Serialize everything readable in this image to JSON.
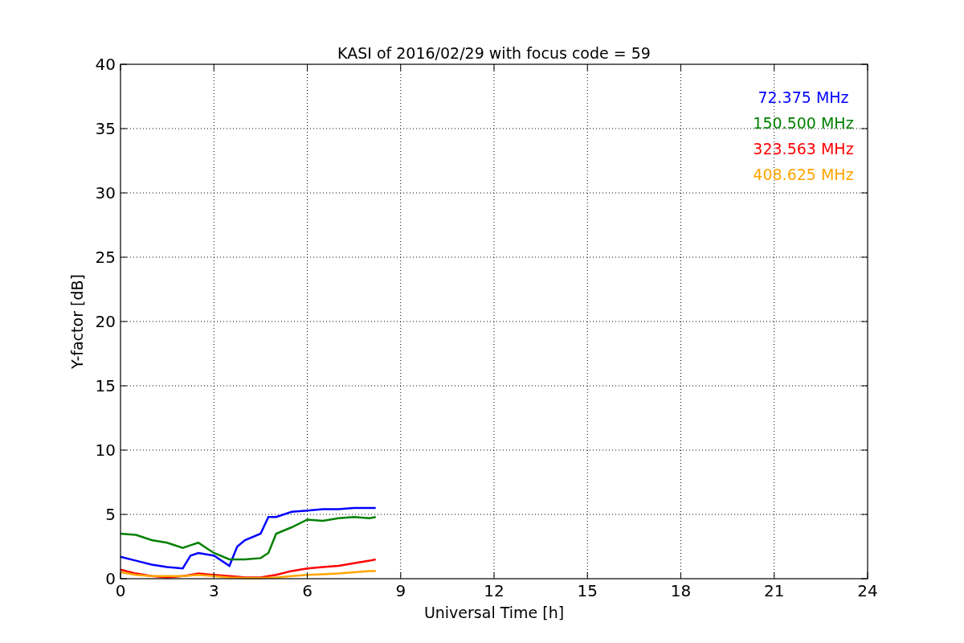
{
  "chart_data": {
    "type": "line",
    "title": "KASI of 2016/02/29 with focus code = 59",
    "xlabel": "Universal Time [h]",
    "ylabel": "Y-factor [dB]",
    "x": [
      0,
      0.5,
      1,
      1.5,
      2,
      2.25,
      2.5,
      3,
      3.5,
      3.75,
      4,
      4.5,
      4.75,
      5,
      5.5,
      6,
      6.5,
      7,
      7.5,
      8,
      8.2
    ],
    "series": [
      {
        "name": "72.375 MHz",
        "color": "#0000ff",
        "values": [
          1.7,
          1.4,
          1.1,
          0.9,
          0.8,
          1.8,
          2.0,
          1.8,
          1.0,
          2.5,
          3.0,
          3.5,
          4.8,
          4.8,
          5.2,
          5.3,
          5.4,
          5.4,
          5.5,
          5.5,
          5.5
        ]
      },
      {
        "name": "150.500 MHz",
        "color": "#008000",
        "values": [
          3.5,
          3.4,
          3.0,
          2.8,
          2.4,
          2.6,
          2.8,
          2.0,
          1.5,
          1.5,
          1.5,
          1.6,
          2.0,
          3.5,
          4.0,
          4.6,
          4.5,
          4.7,
          4.8,
          4.7,
          4.8
        ]
      },
      {
        "name": "323.563 MHz",
        "color": "#ff0000",
        "values": [
          0.7,
          0.4,
          0.2,
          0.1,
          0.2,
          0.3,
          0.4,
          0.3,
          0.2,
          0.15,
          0.1,
          0.1,
          0.2,
          0.3,
          0.6,
          0.8,
          0.9,
          1.0,
          1.2,
          1.4,
          1.5
        ]
      },
      {
        "name": "408.625 MHz",
        "color": "#ffa500",
        "values": [
          0.5,
          0.3,
          0.2,
          0.2,
          0.2,
          0.25,
          0.3,
          0.2,
          0.1,
          0.08,
          0.05,
          0.05,
          0.08,
          0.1,
          0.2,
          0.3,
          0.35,
          0.4,
          0.5,
          0.6,
          0.6
        ]
      }
    ],
    "xlim": [
      0,
      24
    ],
    "ylim": [
      0,
      40
    ],
    "grid": true,
    "xticks": [
      0,
      3,
      6,
      9,
      12,
      15,
      18,
      21,
      24
    ],
    "yticks": [
      0,
      5,
      10,
      15,
      20,
      25,
      30,
      35,
      40
    ]
  }
}
